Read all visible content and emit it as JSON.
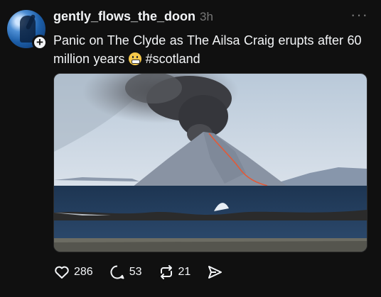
{
  "post": {
    "username": "gently_flows_the_doon",
    "timestamp": "3h",
    "more_label": "···",
    "caption_text": "Panic on The Clyde as The Ailsa Craig erupts after 60 million years",
    "hashtag": "#scotland",
    "emoji_icon": "grimacing-face-emoji",
    "follow_badge_label": "+"
  },
  "actions": {
    "likes": "286",
    "comments": "53",
    "reposts": "21"
  },
  "colors": {
    "background": "#101010",
    "text": "#f3f5f7",
    "secondary": "#777777"
  }
}
